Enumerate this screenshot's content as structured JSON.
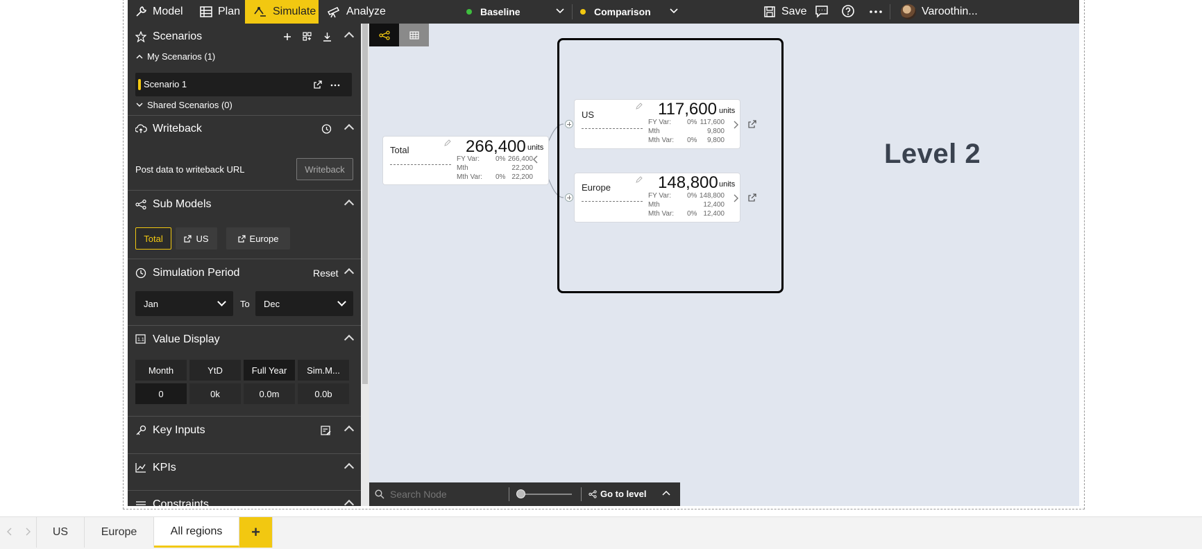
{
  "topbar": {
    "model": "Model",
    "plan": "Plan",
    "simulate": "Simulate",
    "analyze": "Analyze",
    "baseline": "Baseline",
    "comparison": "Comparison",
    "save": "Save",
    "user": "Varoothin...",
    "colors": {
      "accent": "#f2c811",
      "baseline_dot": "#3fbf3f",
      "comparison_dot": "#f2c811"
    }
  },
  "scenarios": {
    "title": "Scenarios",
    "my_scenarios": "My Scenarios (1)",
    "scenario_name": "Scenario 1",
    "shared": "Shared Scenarios (0)"
  },
  "writeback": {
    "title": "Writeback",
    "description": "Post data to writeback URL",
    "button": "Writeback"
  },
  "submodels": {
    "title": "Sub Models",
    "items": [
      "Total",
      "US",
      "Europe"
    ]
  },
  "simulation_period": {
    "title": "Simulation Period",
    "reset": "Reset",
    "from": "Jan",
    "to_label": "To",
    "to": "Dec"
  },
  "value_display": {
    "title": "Value Display",
    "headers": [
      "Month",
      "YtD",
      "Full Year",
      "Sim.M..."
    ],
    "values": [
      "0",
      "0k",
      "0.0m",
      "0.0b"
    ]
  },
  "key_inputs": {
    "title": "Key Inputs"
  },
  "kpis": {
    "title": "KPIs"
  },
  "constraints": {
    "title": "Constraints"
  },
  "nodes": {
    "total": {
      "name": "Total",
      "value": "266,400",
      "unit": "units",
      "fy_var_label": "FY Var:",
      "fy_var_pct": "0%",
      "fy_var_val": "266,400",
      "mth_label": "Mth",
      "mth_val": "22,200",
      "mth_var_label": "Mth Var:",
      "mth_var_pct": "0%",
      "mth_var_val": "22,200"
    },
    "us": {
      "name": "US",
      "value": "117,600",
      "unit": "units",
      "fy_var_label": "FY Var:",
      "fy_var_pct": "0%",
      "fy_var_val": "117,600",
      "mth_label": "Mth",
      "mth_val": "9,800",
      "mth_var_label": "Mth Var:",
      "mth_var_pct": "0%",
      "mth_var_val": "9,800"
    },
    "europe": {
      "name": "Europe",
      "value": "148,800",
      "unit": "units",
      "fy_var_label": "FY Var:",
      "fy_var_pct": "0%",
      "fy_var_val": "148,800",
      "mth_label": "Mth",
      "mth_val": "12,400",
      "mth_var_label": "Mth Var:",
      "mth_var_pct": "0%",
      "mth_var_val": "12,400"
    }
  },
  "annotation": "Level 2",
  "search": {
    "placeholder": "Search Node",
    "go_to_level": "Go to level"
  },
  "tabs": [
    "US",
    "Europe",
    "All regions"
  ],
  "add_tab": "+"
}
